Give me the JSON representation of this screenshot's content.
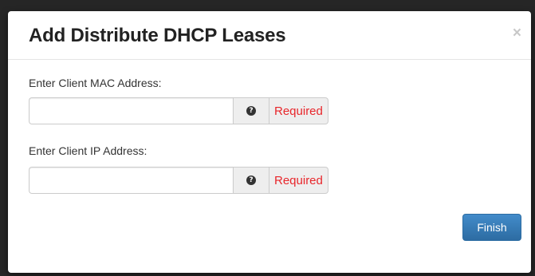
{
  "modal": {
    "title": "Add Distribute DHCP Leases",
    "close_symbol": "×"
  },
  "fields": [
    {
      "label": "Enter Client MAC Address:",
      "value": "",
      "help_icon": "question-circle-icon",
      "required_text": "Required"
    },
    {
      "label": "Enter Client IP Address:",
      "value": "",
      "help_icon": "question-circle-icon",
      "required_text": "Required"
    }
  ],
  "actions": {
    "finish_label": "Finish"
  },
  "colors": {
    "primary_button": "#337ab7",
    "required_text": "#e8262b"
  }
}
